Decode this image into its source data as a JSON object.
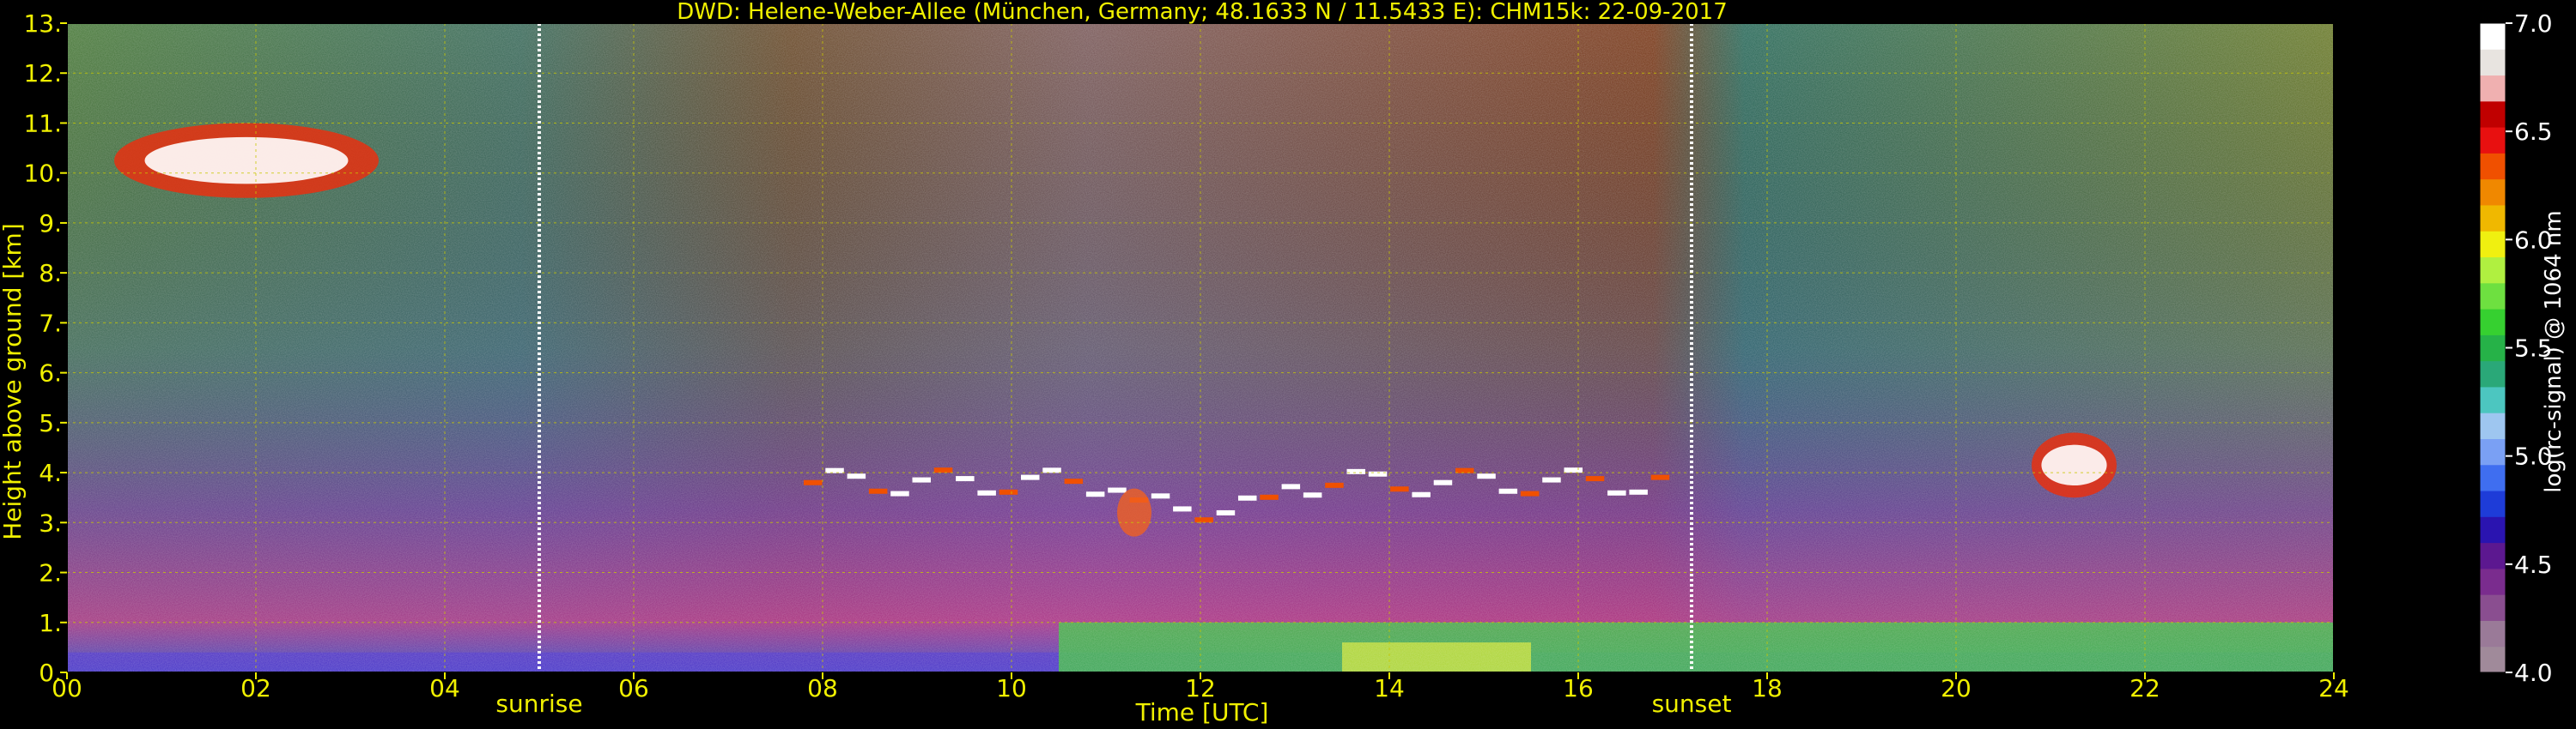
{
  "chart_data": {
    "type": "heatmap",
    "title": "DWD: Helene-Weber-Allee (München, Germany; 48.1633 N / 11.5433 E):    CHM15k: 22-09-2017",
    "xlabel": "Time [UTC]",
    "ylabel": "Height above ground [km]",
    "xlim": [
      0,
      24
    ],
    "ylim": [
      0,
      13
    ],
    "x_ticks": [
      {
        "value": 0,
        "label": "00"
      },
      {
        "value": 2,
        "label": "02"
      },
      {
        "value": 4,
        "label": "04"
      },
      {
        "value": 6,
        "label": "06"
      },
      {
        "value": 8,
        "label": "08"
      },
      {
        "value": 10,
        "label": "10"
      },
      {
        "value": 12,
        "label": "12"
      },
      {
        "value": 14,
        "label": "14"
      },
      {
        "value": 16,
        "label": "16"
      },
      {
        "value": 18,
        "label": "18"
      },
      {
        "value": 20,
        "label": "20"
      },
      {
        "value": 22,
        "label": "22"
      },
      {
        "value": 24,
        "label": "24"
      }
    ],
    "y_ticks": [
      {
        "value": 0,
        "label": "0."
      },
      {
        "value": 1,
        "label": "1."
      },
      {
        "value": 2,
        "label": "2."
      },
      {
        "value": 3,
        "label": "3."
      },
      {
        "value": 4,
        "label": "4."
      },
      {
        "value": 5,
        "label": "5."
      },
      {
        "value": 6,
        "label": "6."
      },
      {
        "value": 7,
        "label": "7."
      },
      {
        "value": 8,
        "label": "8."
      },
      {
        "value": 9,
        "label": "9."
      },
      {
        "value": 10,
        "label": "10."
      },
      {
        "value": 11,
        "label": "11."
      },
      {
        "value": 12,
        "label": "12."
      },
      {
        "value": 13,
        "label": "13."
      }
    ],
    "grid": true,
    "markers": [
      {
        "time": 5.0,
        "label": "sunrise"
      },
      {
        "time": 17.2,
        "label": "sunset"
      }
    ],
    "colorbar": {
      "label": "log(rc-signal) @ 1064 nm",
      "range": [
        4.0,
        7.0
      ],
      "ticks": [
        {
          "value": 4.0,
          "label": "4.0"
        },
        {
          "value": 4.5,
          "label": "4.5"
        },
        {
          "value": 5.0,
          "label": "5.0"
        },
        {
          "value": 5.5,
          "label": "5.5"
        },
        {
          "value": 6.0,
          "label": "6.0"
        },
        {
          "value": 6.5,
          "label": "6.5"
        },
        {
          "value": 7.0,
          "label": "7.0"
        }
      ],
      "colors": [
        "#a08a9a",
        "#9a7a98",
        "#8a4e90",
        "#7a2c8e",
        "#5c1890",
        "#2a14b0",
        "#1e3cd8",
        "#3f6ef0",
        "#7aa0f4",
        "#9ec6f0",
        "#4cc6c0",
        "#2aa878",
        "#26b248",
        "#36d030",
        "#6ee040",
        "#b0f040",
        "#f0f010",
        "#f0b800",
        "#f08800",
        "#f05000",
        "#e81010",
        "#c00000",
        "#f0b0b0",
        "#e8e4e0",
        "#ffffff"
      ]
    },
    "features": [
      {
        "kind": "cirrus cloud",
        "t_start": 0.5,
        "t_end": 3.3,
        "h_bottom": 9.5,
        "h_top": 11.0
      },
      {
        "kind": "mid-level cloud layer",
        "t_start": 7.8,
        "t_end": 17.0,
        "h_bottom": 2.9,
        "h_top": 5.5
      },
      {
        "kind": "cloud",
        "t_start": 20.8,
        "t_end": 21.7,
        "h_bottom": 3.5,
        "h_top": 4.8
      },
      {
        "kind": "boundary layer aerosol",
        "t_start": 0,
        "t_end": 24,
        "h_bottom": 0,
        "h_top": 1.3
      }
    ]
  }
}
